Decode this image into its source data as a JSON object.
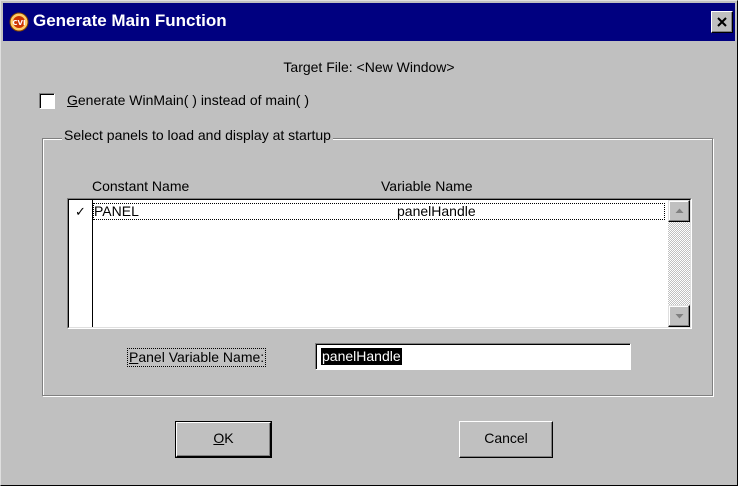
{
  "window": {
    "title": "Generate Main Function",
    "icon": "cvi-app-icon",
    "icon_text": "CVI",
    "close_icon": "close-icon"
  },
  "target_file": {
    "text": "Target File: <New Window>"
  },
  "winmain_option": {
    "checked": false,
    "label_mnemonic": "G",
    "label_rest": "enerate WinMain( ) instead of main( )"
  },
  "panels_group": {
    "legend": "Select panels to load and display at startup",
    "columns": [
      "Constant Name",
      "Variable Name"
    ],
    "rows": [
      {
        "checked": true,
        "check_glyph": "✓",
        "constant": "PANEL",
        "variable": "panelHandle"
      }
    ],
    "scroll_up_icon": "scroll-up-arrow-icon",
    "scroll_down_icon": "scroll-down-arrow-icon"
  },
  "panel_variable": {
    "label_mnemonic": "P",
    "label_rest": "anel Variable Name:",
    "value": "panelHandle"
  },
  "buttons": {
    "ok_mnemonic": "O",
    "ok_rest": "K",
    "cancel": "Cancel"
  },
  "colors": {
    "titlebar": "#000080",
    "face": "#c0c0c0",
    "selection": "#000000"
  }
}
